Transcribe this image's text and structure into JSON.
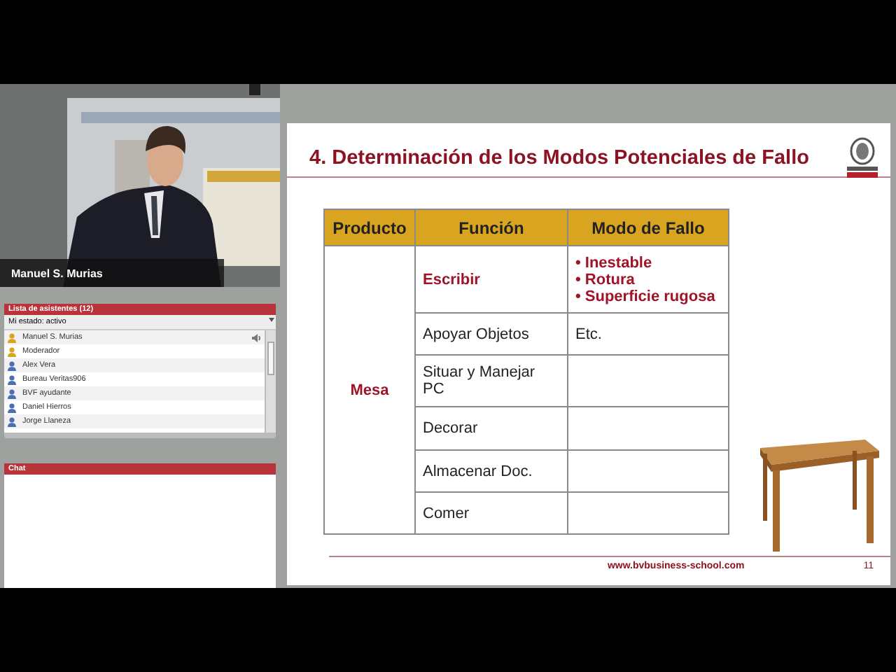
{
  "video": {
    "caption": "Manuel S. Murias"
  },
  "attendees": {
    "title": "Lista de asistentes (12)",
    "status": "Mi estado: activo",
    "items": [
      {
        "name": "Manuel S. Murias",
        "kind": "moderator",
        "speaking": true
      },
      {
        "name": "Moderador",
        "kind": "moderator",
        "speaking": false
      },
      {
        "name": "Alex Vera",
        "kind": "attendee",
        "speaking": false
      },
      {
        "name": "Bureau Veritas906",
        "kind": "attendee",
        "speaking": false
      },
      {
        "name": "BVF ayudante",
        "kind": "attendee",
        "speaking": false
      },
      {
        "name": "Daniel Hierros",
        "kind": "attendee",
        "speaking": false
      },
      {
        "name": "Jorge Llaneza",
        "kind": "attendee",
        "speaking": false
      }
    ]
  },
  "chat": {
    "title": "Chat"
  },
  "slide": {
    "title": "4. Determinación de los Modos Potenciales de Fallo",
    "table": {
      "columns": [
        "Producto",
        "Función",
        "Modo de Fallo"
      ],
      "product": "Mesa",
      "rows": [
        {
          "function": "Escribir",
          "highlight": true,
          "failure_modes": [
            "• Inestable",
            "• Rotura",
            "• Superficie rugosa"
          ]
        },
        {
          "function": "Apoyar Objetos",
          "highlight": false,
          "failure_modes": [
            "Etc."
          ]
        },
        {
          "function": "Situar y Manejar PC",
          "highlight": false,
          "failure_modes": []
        },
        {
          "function": "Decorar",
          "highlight": false,
          "failure_modes": []
        },
        {
          "function": "Almacenar Doc.",
          "highlight": false,
          "failure_modes": []
        },
        {
          "function": "Comer",
          "highlight": false,
          "failure_modes": []
        }
      ]
    },
    "footer_url": "www.bvbusiness-school.com",
    "page": "11"
  }
}
